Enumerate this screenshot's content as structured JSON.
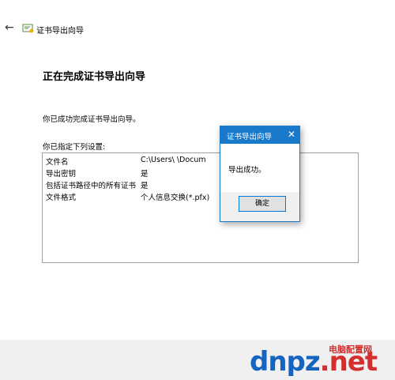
{
  "window": {
    "title": "证书导出向导",
    "back_icon": "←"
  },
  "page": {
    "heading": "正在完成证书导出向导",
    "success_message": "你已成功完成证书导出向导。",
    "settings_label": "你已指定下列设置:"
  },
  "settings": [
    {
      "key": "文件名",
      "value": "C:\\Users\\        \\Docum"
    },
    {
      "key": "导出密钥",
      "value": "是"
    },
    {
      "key": "包括证书路径中的所有证书",
      "value": "是"
    },
    {
      "key": "文件格式",
      "value": "个人信息交换(*.pfx)"
    }
  ],
  "dialog": {
    "title": "证书导出向导",
    "close_icon": "✕",
    "message": "导出成功。",
    "ok_label": "确定"
  },
  "watermark": {
    "logo_text": "dnpz",
    "logo_suffix": ".net",
    "site_name": "电脑配置网"
  },
  "colors": {
    "accent": "#1979ca",
    "dialog_footer": "#f0f0f0",
    "button_border": "#0078d7"
  }
}
